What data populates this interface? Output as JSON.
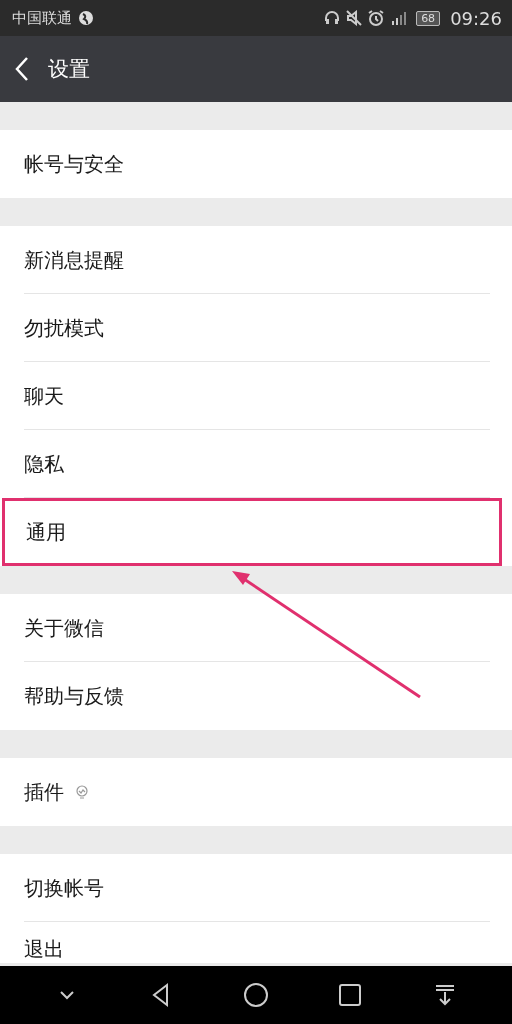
{
  "status_bar": {
    "carrier": "中国联通",
    "battery": "68",
    "time": "09:26"
  },
  "header": {
    "title": "设置"
  },
  "groups": [
    {
      "items": [
        {
          "label": "帐号与安全",
          "highlighted": false
        }
      ]
    },
    {
      "items": [
        {
          "label": "新消息提醒",
          "highlighted": false
        },
        {
          "label": "勿扰模式",
          "highlighted": false
        },
        {
          "label": "聊天",
          "highlighted": false
        },
        {
          "label": "隐私",
          "highlighted": false
        },
        {
          "label": "通用",
          "highlighted": true
        }
      ]
    },
    {
      "items": [
        {
          "label": "关于微信",
          "highlighted": false
        },
        {
          "label": "帮助与反馈",
          "highlighted": false
        }
      ]
    },
    {
      "items": [
        {
          "label": "插件",
          "highlighted": false,
          "bulb": true
        }
      ]
    },
    {
      "items": [
        {
          "label": "切换帐号",
          "highlighted": false
        },
        {
          "label": "退出",
          "highlighted": false,
          "cut": true
        }
      ]
    }
  ]
}
